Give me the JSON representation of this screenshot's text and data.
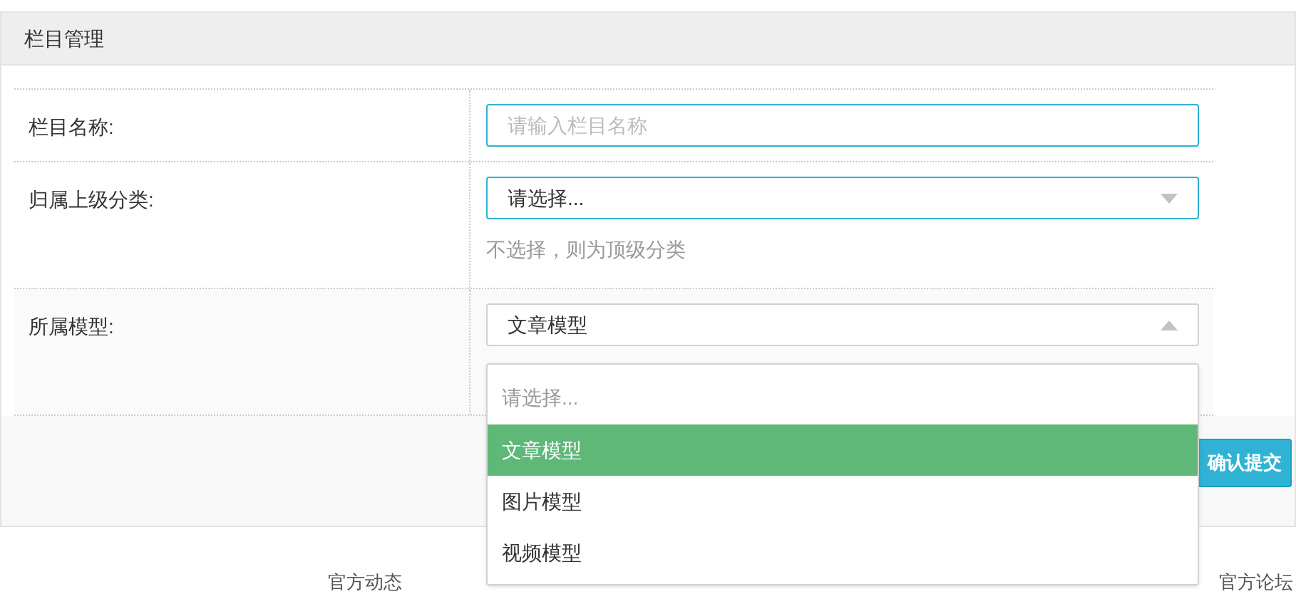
{
  "panel": {
    "title": "栏目管理"
  },
  "fields": [
    {
      "kind": "input",
      "label": "栏目名称:",
      "placeholder": "请输入栏目名称"
    },
    {
      "kind": "select",
      "label": "归属上级分类:",
      "value": "请选择...",
      "expanded": false,
      "hint": "不选择，则为顶级分类"
    },
    {
      "kind": "select",
      "label": "所属模型:",
      "value": "文章模型",
      "expanded": true,
      "menu": {
        "placeholder": "请选择...",
        "options": [
          {
            "label": "文章模型",
            "selected": true
          },
          {
            "label": "图片模型",
            "selected": false
          },
          {
            "label": "视频模型",
            "selected": false
          }
        ]
      }
    }
  ],
  "submit": "确认提交",
  "footer": [
    "官方动态",
    "官方论坛"
  ]
}
